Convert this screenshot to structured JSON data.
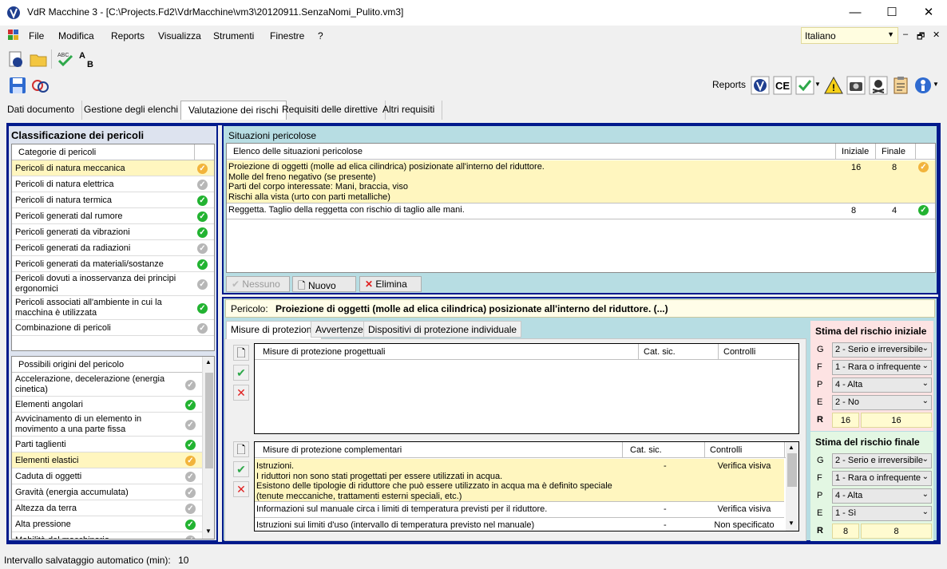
{
  "window": {
    "title": "VdR Macchine 3 - [C:\\Projects.Fd2\\VdrMacchine\\vm3\\20120911.SenzaNomi_Pulito.vm3]",
    "minimize": "—",
    "maximize": "☐",
    "close": "✕"
  },
  "menu": {
    "items": [
      "File",
      "Modifica",
      "Reports",
      "Visualizza",
      "Strumenti",
      "Finestre",
      "?"
    ],
    "language": "Italiano",
    "mdi_min": "–",
    "mdi_restore": "🗗",
    "mdi_close": "✕"
  },
  "toolbar2": {
    "reports_label": "Reports"
  },
  "tabs": [
    "Dati documento",
    "Gestione degli elenchi",
    "Valutazione dei rischi",
    "Requisiti delle direttive",
    "Altri requisiti"
  ],
  "active_tab": "Valutazione dei rischi",
  "left": {
    "title": "Classificazione dei pericoli",
    "categories_header": "Categorie di pericoli",
    "categories": [
      {
        "label": "Pericoli di natura meccanica",
        "status": "yellow",
        "selected": true
      },
      {
        "label": "Pericoli di natura elettrica",
        "status": "gray"
      },
      {
        "label": "Pericoli di natura termica",
        "status": "green"
      },
      {
        "label": "Pericoli generati dal rumore",
        "status": "green"
      },
      {
        "label": "Pericoli generati da vibrazioni",
        "status": "green"
      },
      {
        "label": "Pericoli generati da radiazioni",
        "status": "gray"
      },
      {
        "label": "Pericoli generati da materiali/sostanze",
        "status": "green"
      },
      {
        "label": "Pericoli dovuti a inosservanza dei principi ergonomici",
        "status": "gray"
      },
      {
        "label": "Pericoli associati all'ambiente in cui la macchina è utilizzata",
        "status": "green"
      },
      {
        "label": "Combinazione di pericoli",
        "status": "gray"
      }
    ],
    "origins_header": "Possibili origini del pericolo",
    "origins": [
      {
        "label": "Accelerazione, decelerazione (energia cinetica)",
        "status": "gray"
      },
      {
        "label": "Elementi angolari",
        "status": "green"
      },
      {
        "label": "Avvicinamento di un elemento in movimento a una parte fissa",
        "status": "gray"
      },
      {
        "label": "Parti taglienti",
        "status": "green"
      },
      {
        "label": "Elementi elastici",
        "status": "yellow",
        "selected": true
      },
      {
        "label": "Caduta di oggetti",
        "status": "gray"
      },
      {
        "label": "Gravità (energia accumulata)",
        "status": "gray"
      },
      {
        "label": "Altezza da terra",
        "status": "gray"
      },
      {
        "label": "Alta pressione",
        "status": "green"
      },
      {
        "label": "Mobilità del macchinario",
        "status": "gray"
      }
    ]
  },
  "situations": {
    "title": "Situazioni pericolose",
    "col_list": "Elenco delle situazioni pericolose",
    "col_initial": "Iniziale",
    "col_final": "Finale",
    "rows": [
      {
        "text": "Proiezione di oggetti (molle ad elica cilindrica) posizionate all'interno del riduttore.\nMolle del freno negativo (se presente)\nParti del corpo interessate: Mani, braccia, viso\nRischi alla vista (urto con parti metalliche)",
        "initial": "16",
        "final": "8",
        "status": "yellow",
        "selected": true
      },
      {
        "text": "Reggetta. Taglio della reggetta con rischio di taglio alle mani.",
        "initial": "8",
        "final": "4",
        "status": "green"
      }
    ],
    "btn_none": "Nessuno",
    "btn_new": "Nuovo",
    "btn_delete": "Elimina"
  },
  "detail": {
    "pericolo_label": "Pericolo:",
    "pericolo_value": "Proiezione di oggetti (molle ad elica cilindrica) posizionate all'interno del riduttore. (...)",
    "subtabs": [
      "Misure di protezione",
      "Avvertenze",
      "Dispositivi di protezione individuale"
    ],
    "design": {
      "col_title": "Misure di protezione progettuali",
      "col_cat": "Cat. sic.",
      "col_ctrl": "Controlli"
    },
    "compl": {
      "col_title": "Misure di protezione complementari",
      "col_cat": "Cat. sic.",
      "col_ctrl": "Controlli",
      "rows": [
        {
          "text": "Istruzioni.\nI riduttori non sono stati progettati per essere utilizzati in acqua.\nEsistono delle tipologie di riduttore che può essere utilizzato in acqua ma è definito speciale\n(tenute meccaniche, trattamenti esterni speciali, etc.)",
          "cat": "-",
          "ctrl": "Verifica visiva",
          "selected": true
        },
        {
          "text": "Informazioni sul manuale circa i limiti di temperatura previsti per il riduttore.",
          "cat": "-",
          "ctrl": "Verifica visiva"
        },
        {
          "text": "Istruzioni sui limiti d'uso (intervallo di temperatura previsto nel manuale)",
          "cat": "-",
          "ctrl": "Non specificato"
        }
      ]
    }
  },
  "risk_initial": {
    "title": "Stima del rischio iniziale",
    "G": "2 - Serio e irreversibile",
    "F": "1 - Rara o infrequente",
    "P": "4 - Alta",
    "E": "2 - No",
    "R_label": "R",
    "R1": "16",
    "R2": "16"
  },
  "risk_final": {
    "title": "Stima del rischio finale",
    "G": "2 - Serio e irreversibile",
    "F": "1 - Rara o infrequente",
    "P": "4 - Alta",
    "E": "1 - Sì",
    "R_label": "R",
    "R1": "8",
    "R2": "8"
  },
  "status_bar": {
    "label": "Intervallo salvataggio automatico (min):",
    "value": "10"
  }
}
